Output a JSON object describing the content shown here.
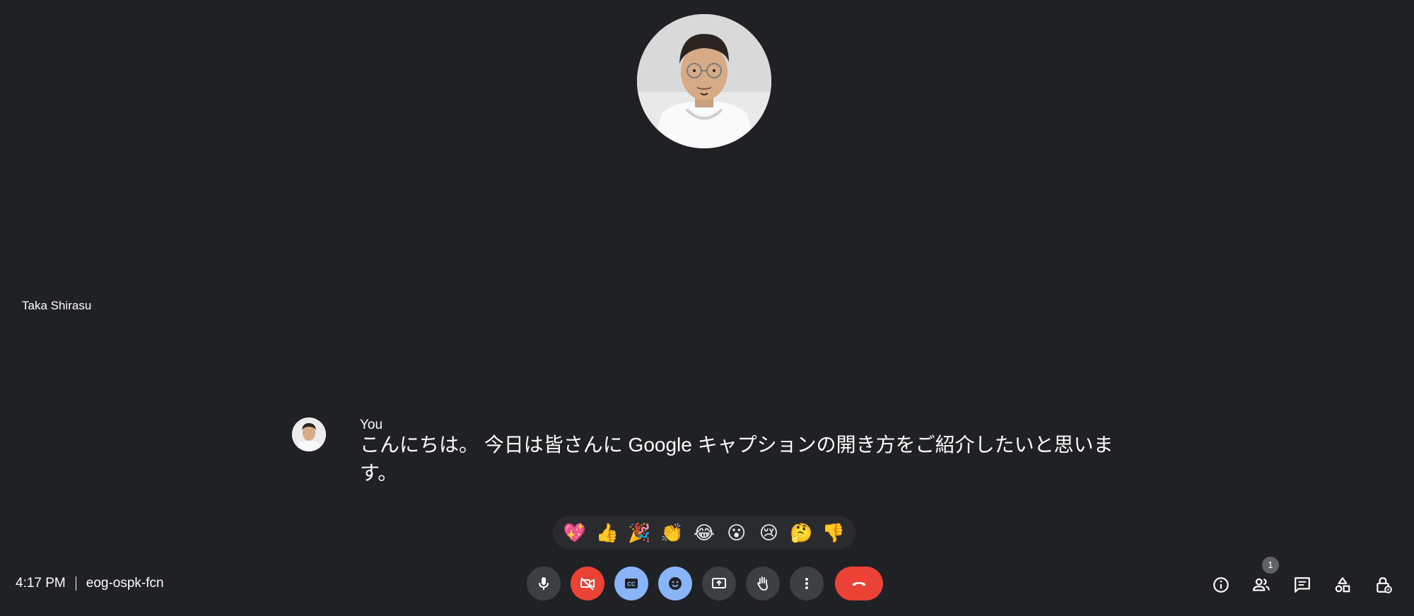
{
  "participant": {
    "name": "Taka Shirasu"
  },
  "caption": {
    "speaker": "You",
    "text": "こんにちは。 今日は皆さんに Google キャプションの開き方をご紹介したいと思います。"
  },
  "reactions": [
    "💖",
    "👍",
    "🎉",
    "👏",
    "😂",
    "😮",
    "😢",
    "🤔",
    "👎"
  ],
  "meeting": {
    "time": "4:17 PM",
    "code": "eog-ospk-fcn"
  },
  "controls": [
    {
      "name": "mic-button",
      "icon": "microphone-icon",
      "style": "gray"
    },
    {
      "name": "camera-off-button",
      "icon": "camera-off-icon",
      "style": "red"
    },
    {
      "name": "captions-button",
      "icon": "closed-captions-icon",
      "style": "blue"
    },
    {
      "name": "reactions-button",
      "icon": "emoji-icon",
      "style": "blue"
    },
    {
      "name": "present-button",
      "icon": "present-screen-icon",
      "style": "gray"
    },
    {
      "name": "raise-hand-button",
      "icon": "hand-icon",
      "style": "gray"
    },
    {
      "name": "more-options-button",
      "icon": "more-vert-icon",
      "style": "gray"
    },
    {
      "name": "leave-call-button",
      "icon": "hangup-icon",
      "style": "red"
    }
  ],
  "side_controls": {
    "people_count": "1",
    "icons": [
      "info-icon",
      "people-icon",
      "chat-icon",
      "activities-icon",
      "host-controls-icon"
    ]
  },
  "colors": {
    "background": "#202124",
    "red": "#ea4335",
    "blue": "#8ab4f8",
    "button_gray": "#3c4043"
  }
}
